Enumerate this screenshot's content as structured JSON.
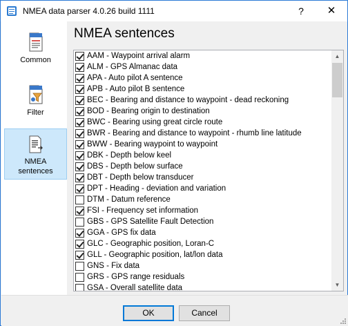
{
  "window": {
    "title": "NMEA data parser 4.0.26 build 1111",
    "help_glyph": "?",
    "close_glyph": "✕"
  },
  "sidebar": {
    "items": [
      {
        "label": "Common",
        "icon": "document-icon",
        "active": false
      },
      {
        "label": "Filter",
        "icon": "filter-icon",
        "active": false
      },
      {
        "label": "NMEA\nsentences",
        "label_line1": "NMEA",
        "label_line2": "sentences",
        "icon": "sentences-icon",
        "active": true
      }
    ]
  },
  "main": {
    "title": "NMEA sentences",
    "sentences": [
      {
        "text": "AAM - Waypoint arrival alarm",
        "checked": true
      },
      {
        "text": "ALM - GPS Almanac data",
        "checked": true
      },
      {
        "text": "APA - Auto pilot A sentence",
        "checked": true
      },
      {
        "text": "APB - Auto pilot B sentence",
        "checked": true
      },
      {
        "text": "BEC - Bearing and distance to waypoint - dead reckoning",
        "checked": true
      },
      {
        "text": "BOD - Bearing origin to destination",
        "checked": true
      },
      {
        "text": "BWC - Bearing using great circle route",
        "checked": true
      },
      {
        "text": "BWR - Bearing and distance to waypoint - rhumb line latitude",
        "checked": true
      },
      {
        "text": "BWW - Bearing waypoint to waypoint",
        "checked": true
      },
      {
        "text": "DBK - Depth below keel",
        "checked": true
      },
      {
        "text": "DBS - Depth below surface",
        "checked": true
      },
      {
        "text": "DBT - Depth below transducer",
        "checked": true
      },
      {
        "text": "DPT - Heading - deviation and variation",
        "checked": true
      },
      {
        "text": "DTM - Datum reference",
        "checked": false
      },
      {
        "text": "FSI - Frequency set information",
        "checked": true
      },
      {
        "text": "GBS - GPS Satellite Fault Detection",
        "checked": false
      },
      {
        "text": "GGA - GPS fix data",
        "checked": true
      },
      {
        "text": "GLC - Geographic position, Loran-C",
        "checked": true
      },
      {
        "text": "GLL - Geographic position, lat/lon data",
        "checked": true
      },
      {
        "text": "GNS - Fix data",
        "checked": false
      },
      {
        "text": "GRS - GPS range residuals",
        "checked": false
      },
      {
        "text": "GSA - Overall satellite data",
        "checked": false
      }
    ]
  },
  "footer": {
    "ok_label": "OK",
    "cancel_label": "Cancel"
  },
  "colors": {
    "accent": "#0078d7",
    "active_nav_bg": "#cde8fb",
    "window_border": "#2b79d6"
  }
}
